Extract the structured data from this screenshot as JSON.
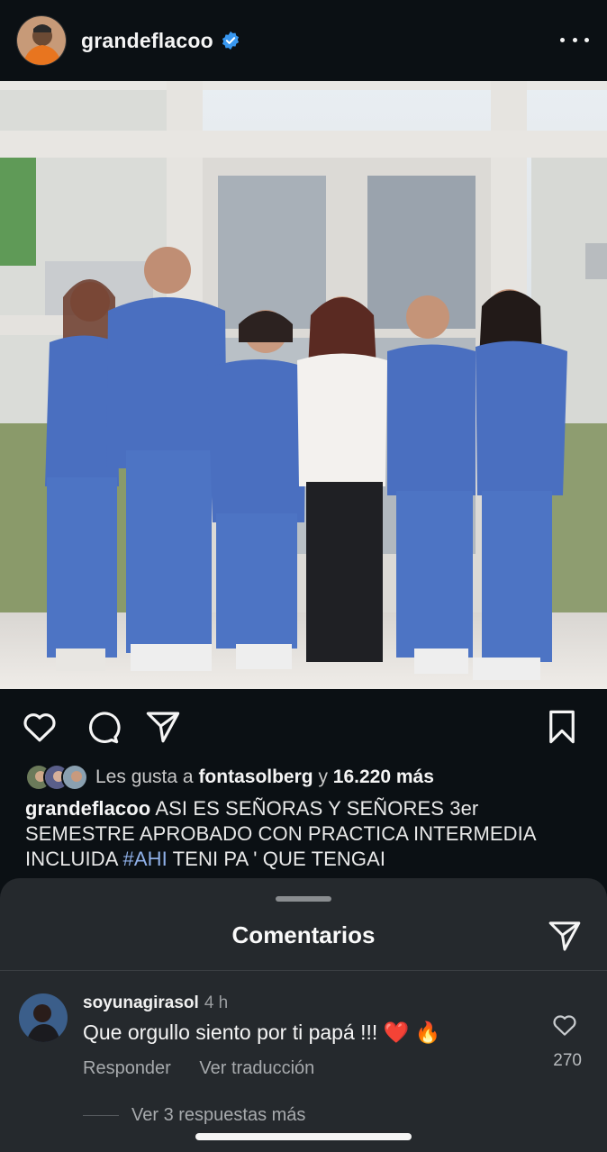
{
  "post": {
    "username": "grandeflacoo",
    "verified": true
  },
  "actions": {
    "icons": [
      "heart-icon",
      "comment-icon",
      "share-icon",
      "bookmark-icon"
    ]
  },
  "likes": {
    "prefix": "Les gusta a",
    "liker": "fontasolberg",
    "connector": "y",
    "count": "16.220 más"
  },
  "caption": {
    "username": "grandeflacoo",
    "text_before": "ASI ES SEÑORAS Y SEÑORES 3er SEMESTRE APROBADO CON PRACTICA INTERMEDIA INCLUIDA",
    "hashtag": "#AHI",
    "text_after": "TENI PA ' QUE TENGAI"
  },
  "comments_sheet": {
    "title": "Comentarios",
    "comments": [
      {
        "username": "soyunagirasol",
        "time": "4 h",
        "text": "Que orgullo siento por ti papá !!! ❤️ 🔥",
        "reply_label": "Responder",
        "translate_label": "Ver traducción",
        "like_count": "270"
      }
    ],
    "more_replies": "Ver 3 respuestas más"
  },
  "colors": {
    "background": "#0b1014",
    "sheet": "#25292d",
    "hashtag": "#8fb0e8",
    "verified": "#3897f0",
    "scrub_blue": "#4a6fc0"
  }
}
